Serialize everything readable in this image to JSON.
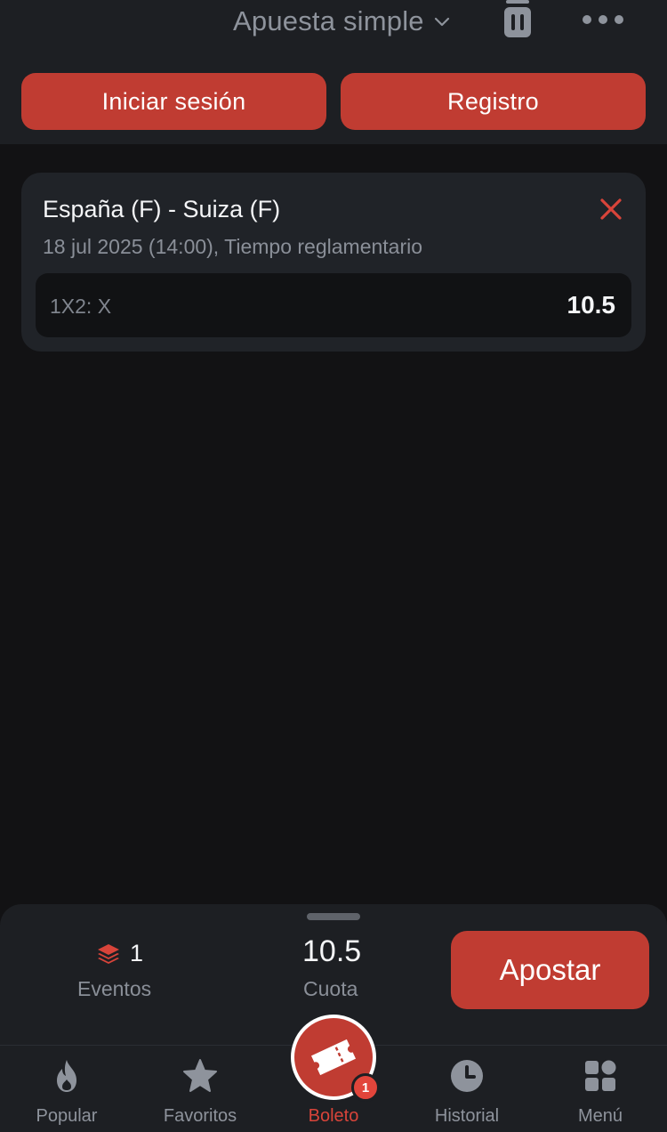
{
  "header": {
    "bet_type": "Apuesta simple",
    "login_label": "Iniciar sesión",
    "register_label": "Registro"
  },
  "bet_card": {
    "match": "España (F) - Suiza (F)",
    "datetime": "18 jul 2025 (14:00), Tiempo reglamentario",
    "market": "1X2: X",
    "odd": "10.5"
  },
  "summary": {
    "events_count": "1",
    "events_label": "Eventos",
    "odds_value": "10.5",
    "odds_label": "Cuota",
    "bet_button": "Apostar"
  },
  "tabs": [
    {
      "label": "Popular",
      "icon": "flame-icon"
    },
    {
      "label": "Favoritos",
      "icon": "star-icon"
    },
    {
      "label": "Boleto",
      "icon": "ticket-icon",
      "active": true
    },
    {
      "label": "Historial",
      "icon": "clock-icon"
    },
    {
      "label": "Menú",
      "icon": "grid-icon"
    }
  ],
  "ticket_badge": "1",
  "colors": {
    "accent": "#c03c32",
    "background": "#121214",
    "surface": "#1d1f23",
    "card": "#202328"
  }
}
